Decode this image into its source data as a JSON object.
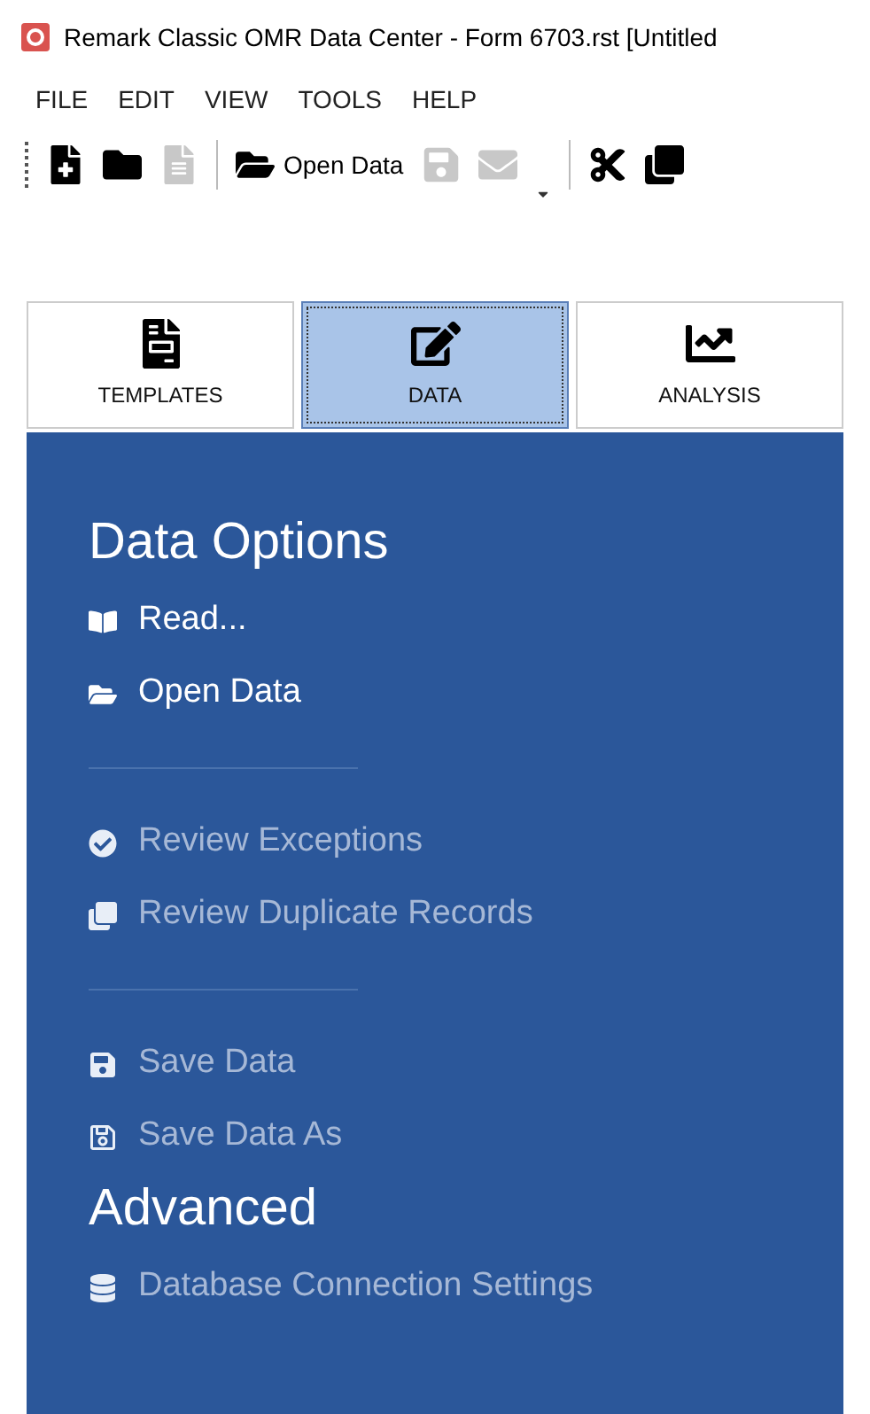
{
  "window": {
    "title": "Remark Classic OMR Data Center - Form 6703.rst [Untitled"
  },
  "menu": [
    "FILE",
    "EDIT",
    "VIEW",
    "TOOLS",
    "HELP"
  ],
  "toolbar": [
    {
      "kind": "button",
      "disabled": false
    },
    {
      "kind": "button",
      "disabled": false
    },
    {
      "kind": "button",
      "disabled": true
    },
    {
      "kind": "separator"
    },
    {
      "kind": "button",
      "label": "Open Data",
      "disabled": false
    },
    {
      "kind": "button",
      "disabled": true
    },
    {
      "kind": "button",
      "disabled": true
    },
    {
      "kind": "dropdown",
      "disabled": false
    },
    {
      "kind": "separator"
    },
    {
      "kind": "button",
      "disabled": false
    },
    {
      "kind": "button",
      "disabled": false
    }
  ],
  "tabs": [
    {
      "label": "TEMPLATES",
      "selected": false
    },
    {
      "label": "DATA",
      "selected": true
    },
    {
      "label": "ANALYSIS",
      "selected": false
    }
  ],
  "panel": [
    {
      "kind": "heading",
      "label": "Data Options"
    },
    {
      "kind": "item",
      "label": "Read...",
      "disabled": false
    },
    {
      "kind": "item",
      "label": "Open Data",
      "disabled": false
    },
    {
      "kind": "separator"
    },
    {
      "kind": "item",
      "label": "Review Exceptions",
      "disabled": true
    },
    {
      "kind": "item",
      "label": "Review Duplicate Records",
      "disabled": true
    },
    {
      "kind": "separator"
    },
    {
      "kind": "item",
      "label": "Save Data",
      "disabled": true
    },
    {
      "kind": "item",
      "label": "Save Data As",
      "disabled": true
    },
    {
      "kind": "heading",
      "label": "Advanced"
    },
    {
      "kind": "item",
      "label": "Database Connection Settings",
      "disabled": true
    }
  ]
}
